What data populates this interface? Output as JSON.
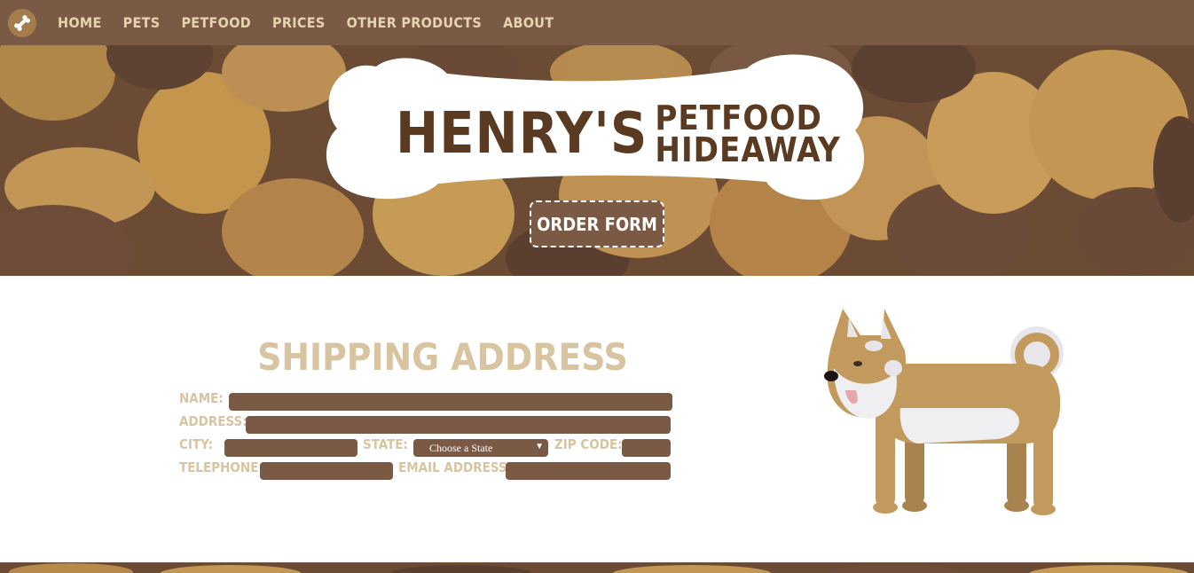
{
  "nav": {
    "items": [
      "HOME",
      "PETS",
      "PETFOOD",
      "PRICES",
      "OTHER PRODUCTS",
      "ABOUT"
    ]
  },
  "hero": {
    "title_big": "HENRY'S",
    "title_line1": "PETFOOD",
    "title_line2": "HIDEAWAY",
    "order_button": "ORDER FORM"
  },
  "form": {
    "title": "SHIPPING ADDRESS",
    "name_label": "NAME:",
    "address_label": "ADDRESS:",
    "city_label": "CITY:",
    "state_label": "STATE:",
    "state_value": "Choose a State",
    "zip_label": "ZIP CODE:",
    "telephone_label": "TELEPHONE:",
    "email_label": "EMAIL ADDRESS:"
  },
  "colors": {
    "nav_bg": "#7b5a45",
    "nav_text": "#e6d3b0",
    "label": "#d8c4a0",
    "field": "#7b5a45"
  }
}
